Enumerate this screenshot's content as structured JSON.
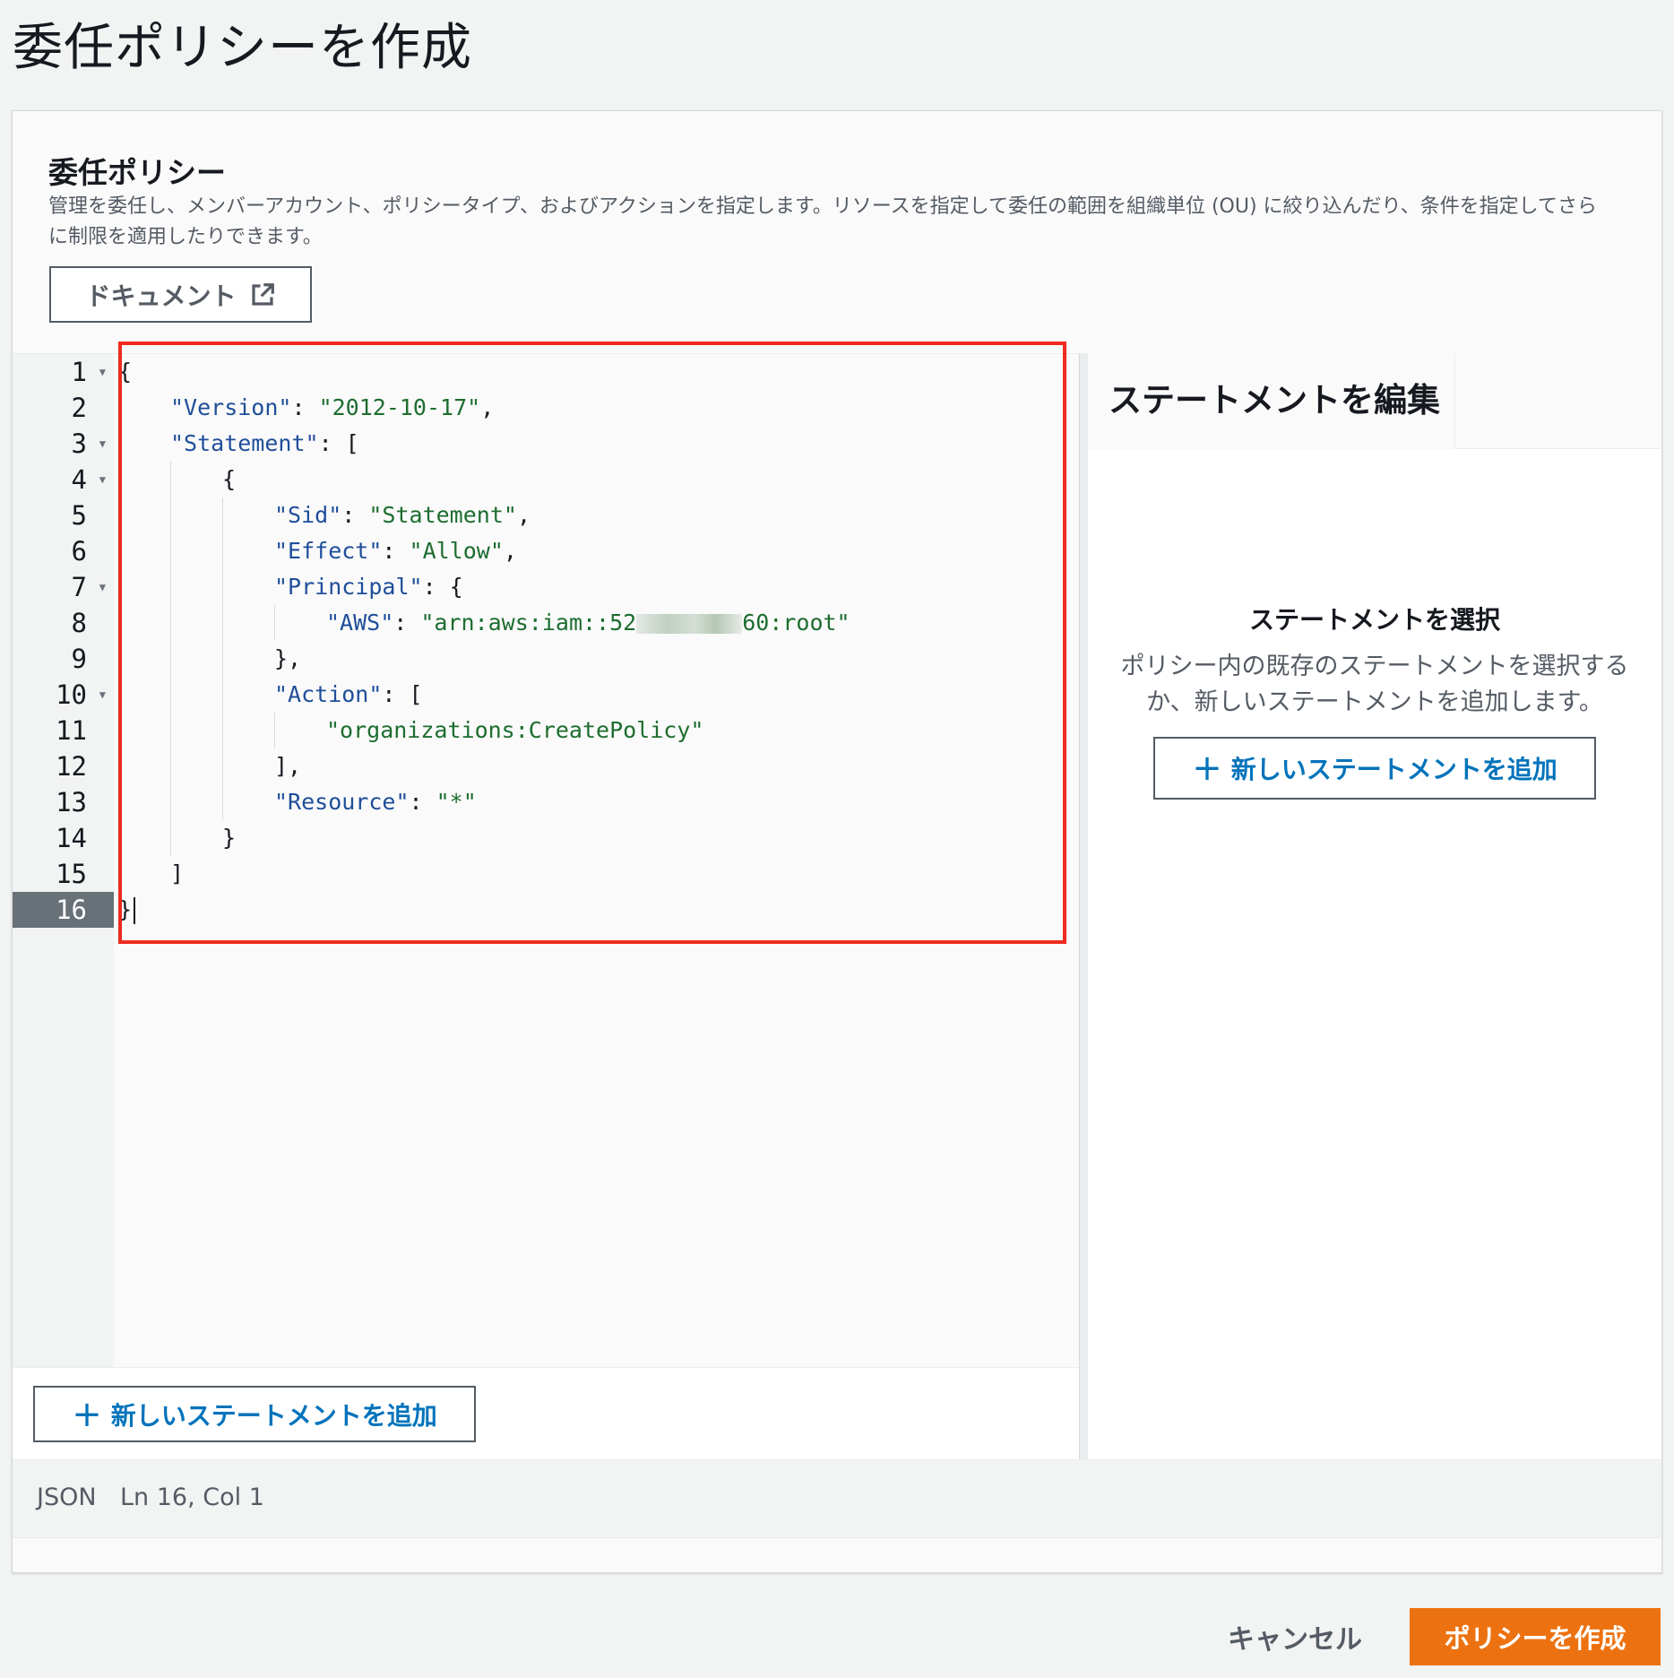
{
  "page": {
    "title": "委任ポリシーを作成"
  },
  "panel": {
    "heading": "委任ポリシー",
    "description": "管理を委任し、メンバーアカウント、ポリシータイプ、およびアクションを指定します。リソースを指定して委任の範囲を組織単位 (OU) に絞り込んだり、条件を指定してさらに制限を適用したりできます。",
    "doc_button": {
      "label": "ドキュメント",
      "icon": "external-link-icon"
    }
  },
  "editor": {
    "line_numbers": [
      "1",
      "2",
      "3",
      "4",
      "5",
      "6",
      "7",
      "8",
      "9",
      "10",
      "11",
      "12",
      "13",
      "14",
      "15",
      "16"
    ],
    "active_line": "16",
    "lines": {
      "l1": {
        "p1": "{"
      },
      "l2": {
        "k": "\"Version\"",
        "p1": ": ",
        "v": "\"2012-10-17\"",
        "p2": ","
      },
      "l3": {
        "k": "\"Statement\"",
        "p1": ": ["
      },
      "l4": {
        "p1": "{"
      },
      "l5": {
        "k": "\"Sid\"",
        "p1": ": ",
        "v": "\"Statement\"",
        "p2": ","
      },
      "l6": {
        "k": "\"Effect\"",
        "p1": ": ",
        "v": "\"Allow\"",
        "p2": ","
      },
      "l7": {
        "k": "\"Principal\"",
        "p1": ": {"
      },
      "l8": {
        "k": "\"AWS\"",
        "p1": ": ",
        "v_start": "\"arn:aws:iam::52",
        "v_end": "60:root\""
      },
      "l9": {
        "p1": "},"
      },
      "l10": {
        "k": "\"Action\"",
        "p1": ": ["
      },
      "l11": {
        "v": "\"organizations:CreatePolicy\""
      },
      "l12": {
        "p1": "],"
      },
      "l13": {
        "k": "\"Resource\"",
        "p1": ": ",
        "v": "\"*\""
      },
      "l14": {
        "p1": "}"
      },
      "l15": {
        "p1": "]"
      },
      "l16": {
        "p1": "}"
      }
    },
    "add_statement_label": "新しいステートメントを追加"
  },
  "side_panel": {
    "tab_label": "ステートメントを編集",
    "heading": "ステートメントを選択",
    "description": "ポリシー内の既存のステートメントを選択するか、新しいステートメントを追加します。",
    "add_statement_label": "新しいステートメントを追加"
  },
  "status_bar": {
    "language": "JSON",
    "position": "Ln 16, Col 1"
  },
  "footer": {
    "cancel_label": "キャンセル",
    "create_label": "ポリシーを作成"
  },
  "colors": {
    "primary_button": "#ec7211",
    "link_blue": "#0073bb",
    "highlight_red": "#ee2b1e",
    "json_key": "#1f4e9a",
    "json_string": "#1d6d2f"
  }
}
